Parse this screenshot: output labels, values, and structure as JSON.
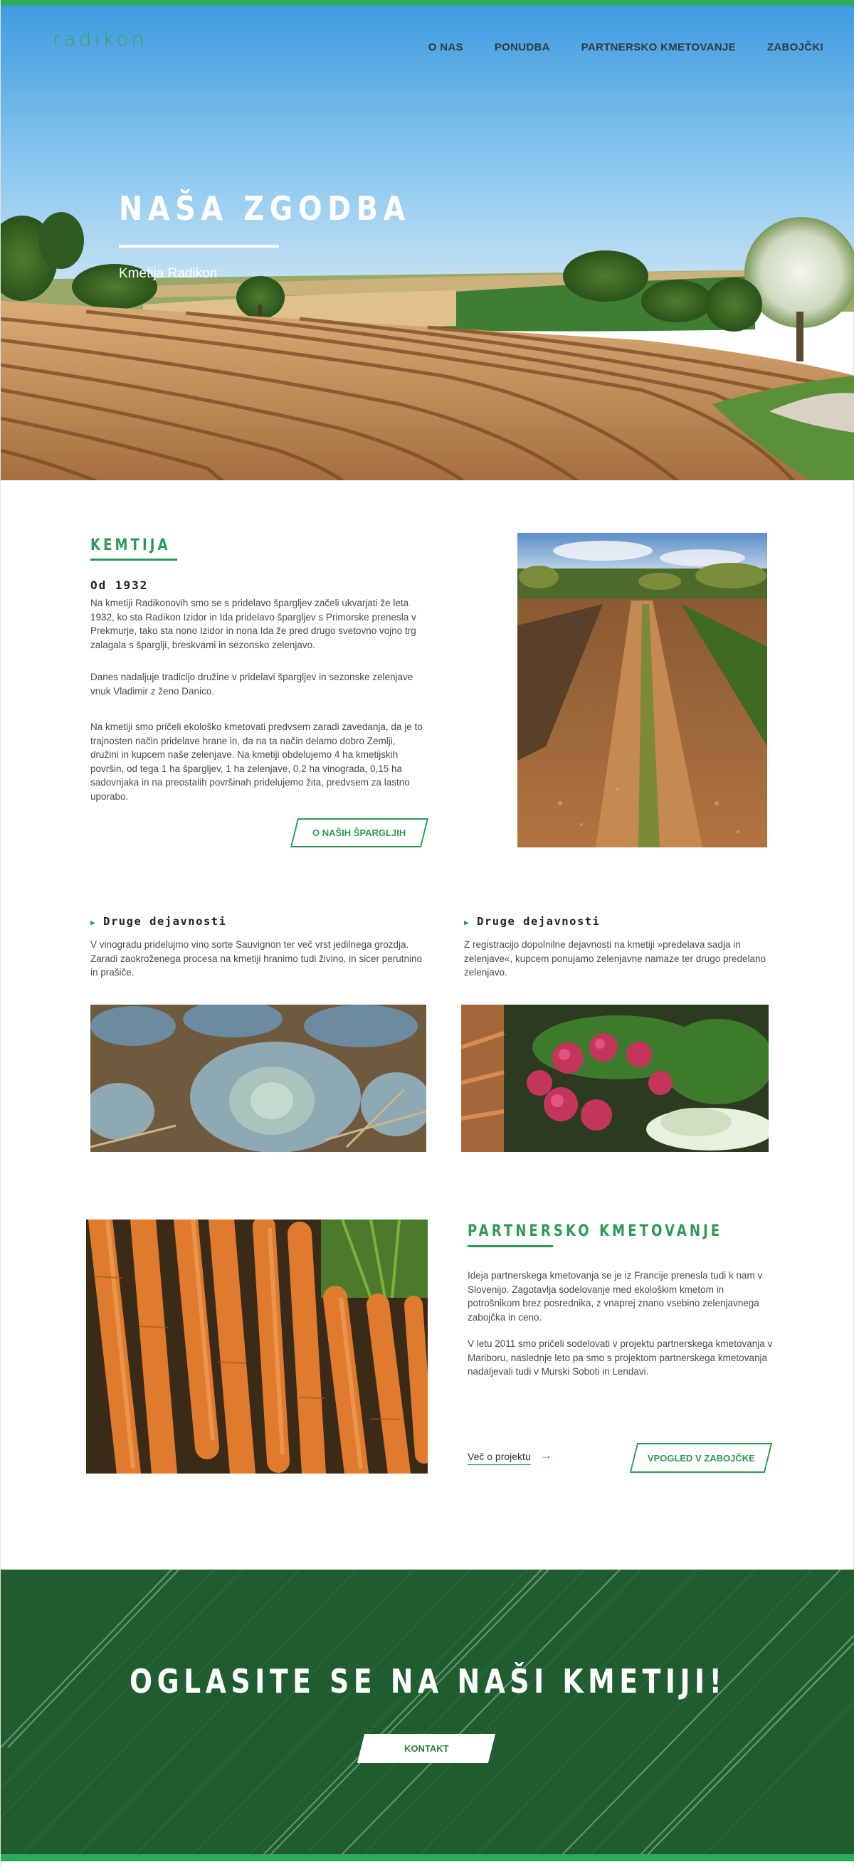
{
  "header": {
    "logo": "radikon",
    "nav": [
      "O NAS",
      "PONUDBA",
      "PARTNERSKO KMETOVANJE",
      "ZABOJČKI"
    ]
  },
  "hero": {
    "title": "NAŠA ZGODBA",
    "subtitle": "Kmetija Radikon"
  },
  "kmetija": {
    "title": "KEMTIJA",
    "subtitle": "Od 1932",
    "p1": "Na kmetiji Radikonovih smo se s pridelavo špargljev začeli ukvarjati že leta 1932, ko sta Radikon Izidor in Ida pridelavo špargljev s Primorske prenesla v Prekmurje, tako sta nono Izidor in nona Ida že pred drugo svetovno vojno trg zalagala s šparglji, breskvami in sezonsko zelenjavo.",
    "p2": "Danes nadaljuje tradicijo družine v pridelavi špargljev in sezonske zelenjave vnuk Vladimir z ženo Danico.",
    "p3": "Na kmetiji smo pričeli ekološko kmetovati predvsem zaradi zavedanja, da je to trajnosten način pridelave hrane in, da na ta način delamo dobro Zemlji, družini in kupcem naše zelenjave. Na kmetiji obdelujemo 4 ha kmetijskih površin, od tega 1 ha špargljev, 1 ha zelenjave, 0,2 ha vinograda, 0,15 ha sadovnjaka in na preostalih površinah pridelujemo žita, predvsem za lastno uporabo.",
    "button": "O NAŠIH ŠPARGLJIH"
  },
  "druge": [
    {
      "title": "Druge dejavnosti",
      "text": "V vinogradu pridelujmo vino sorte Sauvignon ter več vrst jedilnega grozdja. Zaradi zaokroženega procesa na kmetiji hranimo tudi živino, in sicer perutnino in prašiče."
    },
    {
      "title": "Druge dejavnosti",
      "text": "Z registracijo dopolnilne dejavnosti na kmetiji »predelava sadja in zelenjave«, kupcem ponujamo zelenjavne namaze ter drugo predelano zelenjavo."
    }
  ],
  "partnersko": {
    "title": "PARTNERSKO KMETOVANJE",
    "p1": "Ideja partnerskega kmetovanja se je iz Francije prenesla tudi k nam v Slovenijo. Zagotavlja sodelovanje med ekološkim kmetom in potrošnikom brez posrednika, z vnaprej znano vsebino zelenjavnega zabojčka in ceno.",
    "p2": "V letu 2011 smo pričeli sodelovati v projektu partnerskega kmetovanja v Mariboru, naslednje leto pa smo s projektom partnerskega kmetovanja nadaljevali tudi v Murski Soboti in Lendavi.",
    "link": "Več o projektu",
    "button": "VPOGLED V ZABOJČKE"
  },
  "cta": {
    "title": "OGLASITE SE NA NAŠI KMETIJI!",
    "button": "KONTAKT"
  },
  "colors": {
    "accent": "#2c9a55",
    "bar": "#2eaa5c",
    "nav": "#2f3a46"
  }
}
